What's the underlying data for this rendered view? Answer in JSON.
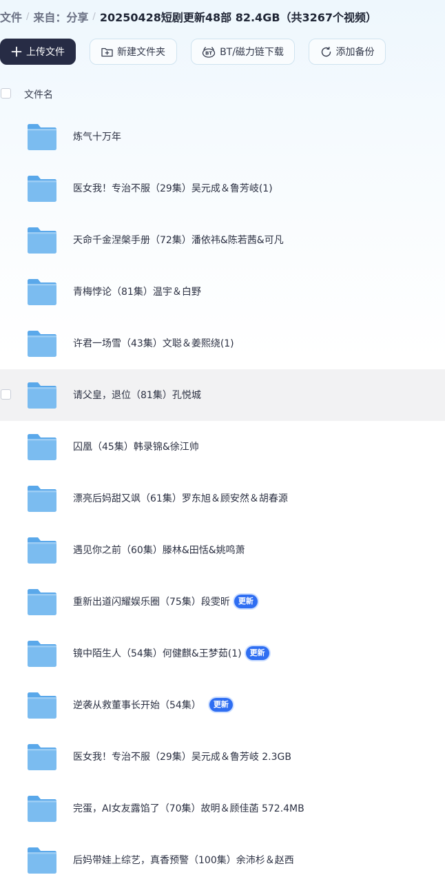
{
  "breadcrumb": {
    "items": [
      "文件",
      "来自：分享"
    ],
    "current": "20250428短剧更新48部 82.4GB（共3267个视频）"
  },
  "toolbar": {
    "upload_label": "上传文件",
    "new_folder_label": "新建文件夹",
    "bt_label": "BT/磁力链下载",
    "add_backup_label": "添加备份"
  },
  "list": {
    "header_label": "文件名",
    "rows": [
      {
        "name": "炼气十万年",
        "badge": ""
      },
      {
        "name": "医女我！专治不服（29集）吴元成＆鲁芳岐(1)",
        "badge": ""
      },
      {
        "name": "天命千金涅槃手册（72集）潘依祎&陈若茜&可凡",
        "badge": ""
      },
      {
        "name": "青梅悖论（81集）温宇＆白野",
        "badge": ""
      },
      {
        "name": "许君一场雪（43集）文聪＆姜熙绕(1)",
        "badge": ""
      },
      {
        "name": "请父皇，退位（81集）孔悦城",
        "badge": ""
      },
      {
        "name": "囚凰（45集）韩录锦&徐江帅",
        "badge": ""
      },
      {
        "name": "漂亮后妈甜又飒（61集）罗东旭＆顾安然＆胡春源",
        "badge": ""
      },
      {
        "name": "遇见你之前（60集）滕林&田恬&姚鸣萧",
        "badge": ""
      },
      {
        "name": "重新出道闪耀娱乐圈（75集）段雯昕",
        "badge": "更新"
      },
      {
        "name": "镜中陌生人（54集）何健麒&王梦茹(1)",
        "badge": "更新"
      },
      {
        "name": "逆袭从救董事长开始（54集）",
        "badge": "更新"
      },
      {
        "name": "医女我！专治不服（29集）吴元成＆鲁芳岐 2.3GB",
        "badge": ""
      },
      {
        "name": "完蛋，AI女友露馅了（70集）故明＆顾佳菡 572.4MB",
        "badge": ""
      },
      {
        "name": "后妈带娃上综艺，真香预警（100集）余沛杉＆赵西",
        "badge": ""
      }
    ]
  },
  "colors": {
    "primary_button": "#272c45",
    "badge": "#2f6ef2",
    "folder": "#7bbcf0",
    "hover_row": "#f2f2f3"
  },
  "icons": {
    "upload": "plus-icon",
    "new_folder": "folder-plus-icon",
    "bt": "bt-icon",
    "backup": "refresh-icon",
    "folder": "folder-icon"
  }
}
